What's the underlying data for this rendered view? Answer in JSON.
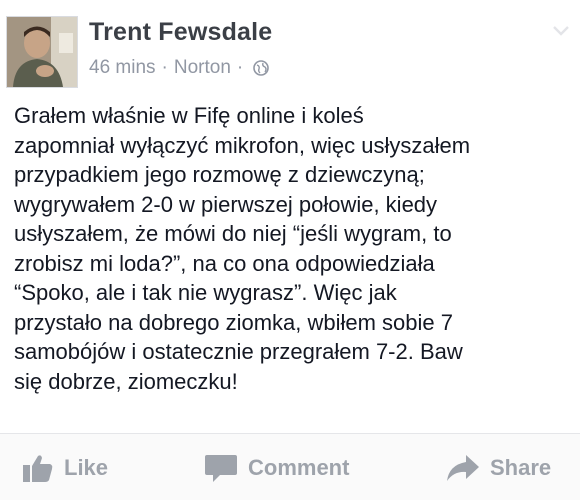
{
  "post": {
    "author": "Trent Fewsdale",
    "time": "46 mins",
    "location": "Norton",
    "separator": "·",
    "audience_icon": "globe-icon",
    "options_icon": "chevron-down-icon",
    "text": "Grałem właśnie w Fifę online i koleś\nzapomniał wyłączyć mikrofon, więc usłyszałem\nprzypadkiem jego rozmowę z dziewczyną;\nwygrywałem 2-0 w pierwszej połowie, kiedy\nusłyszałem, że mówi do niej “jeśli wygram, to\nzrobisz mi loda?”, na co ona odpowiedziała\n“Spoko, ale i tak nie wygrasz”. Więc jak\nprzystało na dobrego ziomka, wbiłem sobie 7\nsamobójów i ostatecznie przegrałem 7-2. Baw\nsię dobrze, ziomeczku!"
  },
  "actions": {
    "like": {
      "label": "Like",
      "icon": "thumbs-up-icon"
    },
    "comment": {
      "label": "Comment",
      "icon": "comment-bubble-icon"
    },
    "share": {
      "label": "Share",
      "icon": "share-arrow-icon"
    }
  },
  "colors": {
    "action_gray": "#9ea3ab",
    "meta_gray": "#9197a3",
    "name": "#3b3f46"
  }
}
